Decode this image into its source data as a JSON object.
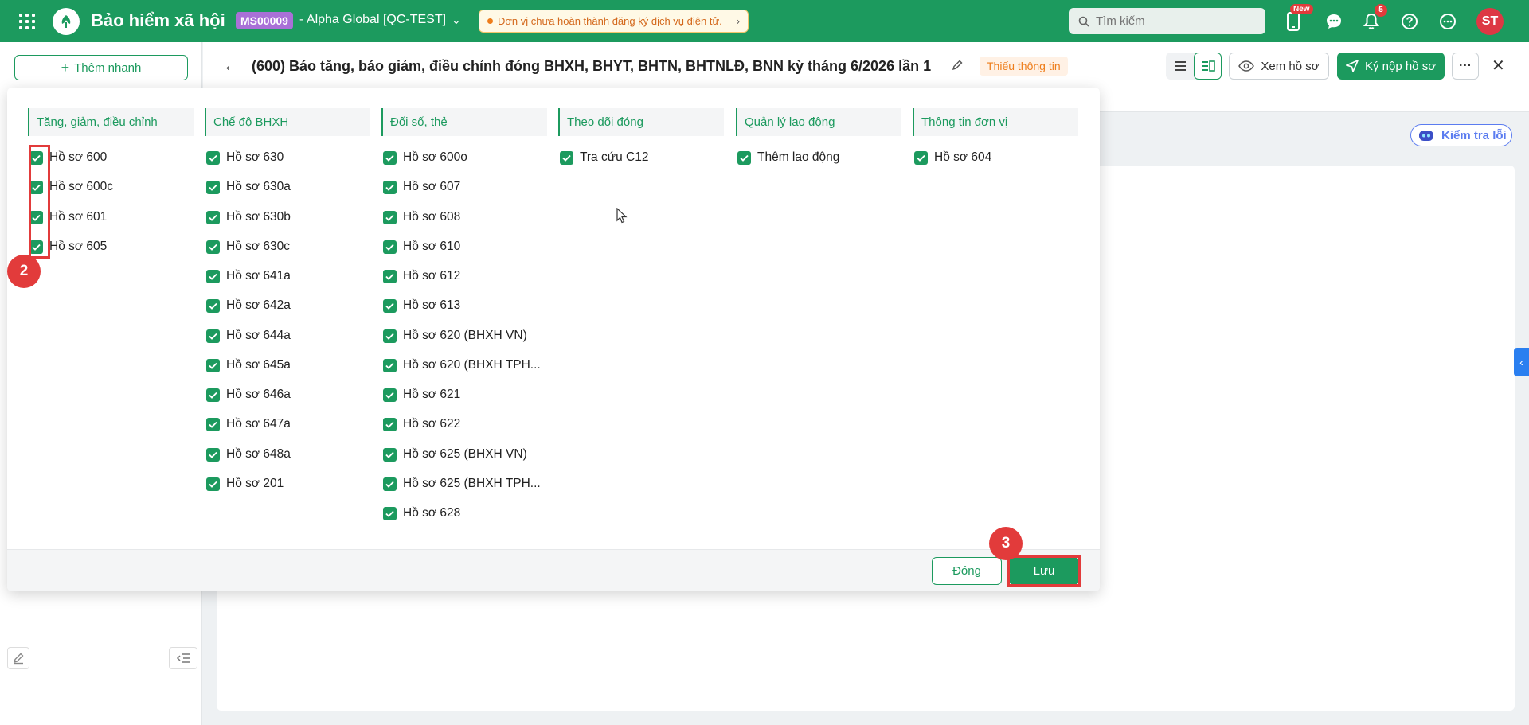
{
  "topbar": {
    "app_title": "Bảo hiểm xã hội",
    "org_code": "MS00009",
    "org_name": "- Alpha Global [QC-TEST]",
    "warning": "Đơn vị chưa hoàn thành đăng ký dịch vụ điện tử.",
    "search_placeholder": "Tìm kiếm",
    "new_badge": "New",
    "notif_count": "5",
    "avatar": "ST"
  },
  "sidebar": {
    "quick_add": "Thêm nhanh"
  },
  "header": {
    "title": "(600) Báo tăng, báo giảm, điều chỉnh đóng BHXH, BHYT, BHTN, BHTNLĐ, BNN kỳ tháng 6/2026 lần 1",
    "status_badge": "Thiếu thông tin",
    "view_label": "Xem hồ sơ",
    "submit_label": "Ký nộp hồ sơ",
    "more_label": "···",
    "check_errors": "Kiểm tra lỗi"
  },
  "popup": {
    "columns": [
      {
        "title": "Tăng, giảm, điều chỉnh",
        "items": [
          "Hồ sơ 600",
          "Hồ sơ 600c",
          "Hồ sơ 601",
          "Hồ sơ 605"
        ]
      },
      {
        "title": "Chế độ BHXH",
        "items": [
          "Hồ sơ 630",
          "Hồ sơ 630a",
          "Hồ sơ 630b",
          "Hồ sơ 630c",
          "Hồ sơ 641a",
          "Hồ sơ 642a",
          "Hồ sơ 644a",
          "Hồ sơ 645a",
          "Hồ sơ 646a",
          "Hồ sơ 647a",
          "Hồ sơ 648a",
          "Hồ sơ 201"
        ]
      },
      {
        "title": "Đối số, thẻ",
        "items": [
          "Hồ sơ 600o",
          "Hồ sơ 607",
          "Hồ sơ 608",
          "Hồ sơ 610",
          "Hồ sơ 612",
          "Hồ sơ 613",
          "Hồ sơ 620 (BHXH VN)",
          "Hồ sơ 620 (BHXH TPH...",
          "Hồ sơ 621",
          "Hồ sơ 622",
          "Hồ sơ 625 (BHXH VN)",
          "Hồ sơ 625 (BHXH TPH...",
          "Hồ sơ 628"
        ]
      },
      {
        "title": "Theo dõi đóng",
        "items": [
          "Tra cứu C12"
        ]
      },
      {
        "title": "Quản lý lao động",
        "items": [
          "Thêm lao động"
        ]
      },
      {
        "title": "Thông tin đơn vị",
        "items": [
          "Hồ sơ 604"
        ]
      }
    ],
    "close_label": "Đóng",
    "save_label": "Lưu"
  },
  "annotations": {
    "step2": "2",
    "step3": "3"
  },
  "colors": {
    "brand": "#1c9a5e",
    "annotation": "#e23b3b",
    "org_badge": "#a970d7"
  }
}
